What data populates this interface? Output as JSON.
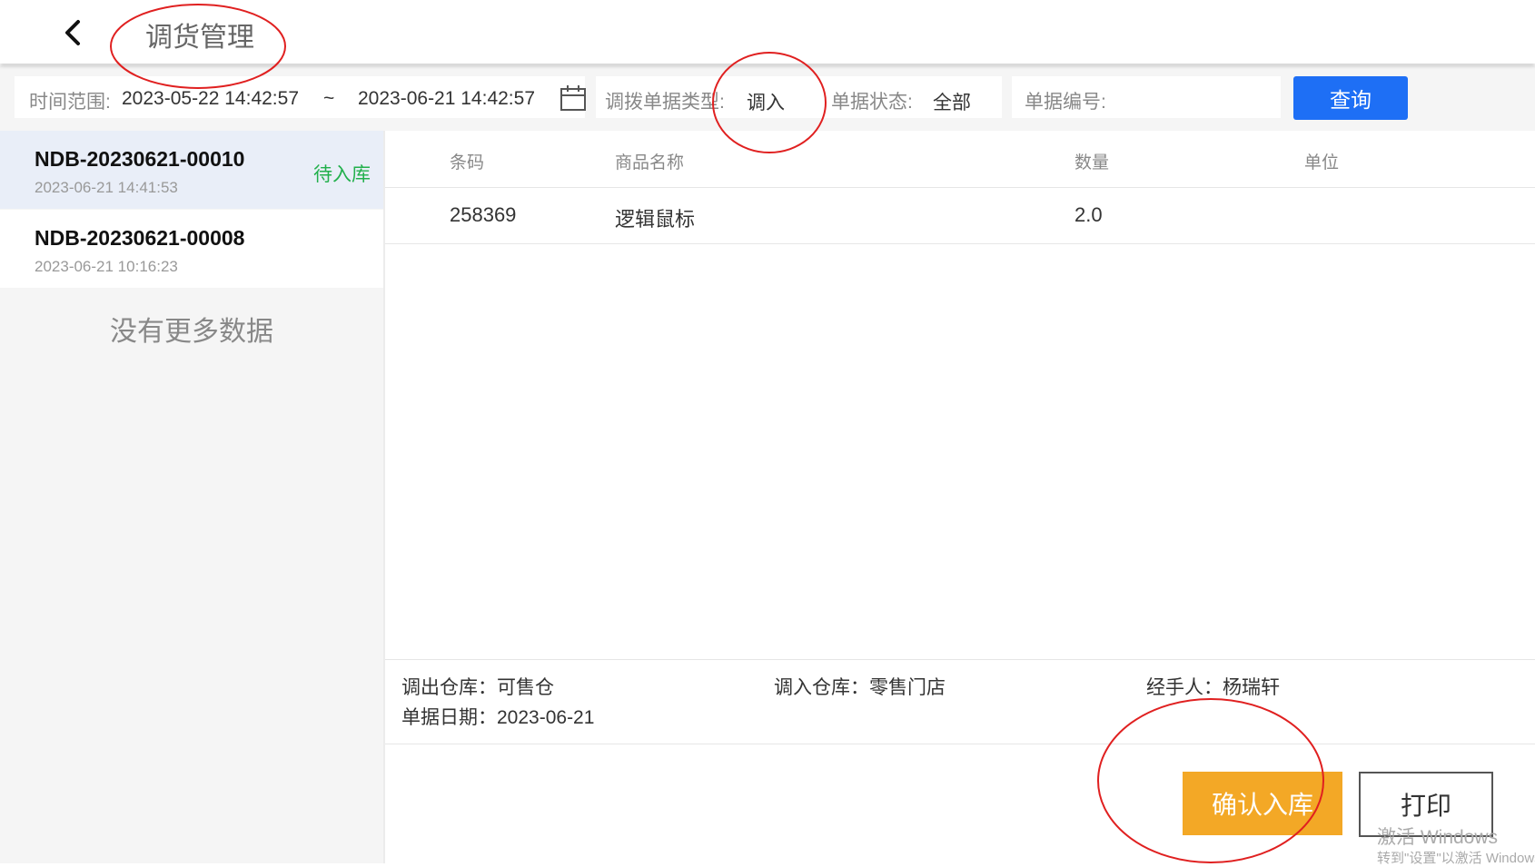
{
  "header": {
    "title": "调货管理"
  },
  "filters": {
    "time_label": "时间范围:",
    "start": "2023-05-22 14:42:57",
    "tilde": "~",
    "end": "2023-06-21 14:42:57",
    "type_label": "调拨单据类型:",
    "type_value": "调入",
    "status_label": "单据状态:",
    "status_value": "全部",
    "number_label": "单据编号:",
    "number_value": "",
    "query_label": "查询"
  },
  "orders": [
    {
      "no": "NDB-20230621-00010",
      "time": "2023-06-21 14:41:53",
      "status": "待入库"
    },
    {
      "no": "NDB-20230621-00008",
      "time": "2023-06-21 10:16:23",
      "status": ""
    }
  ],
  "no_more": "没有更多数据",
  "table": {
    "headers": [
      "条码",
      "商品名称",
      "数量",
      "单位"
    ],
    "rows": [
      [
        "258369",
        "逻辑鼠标",
        "2.0",
        ""
      ]
    ]
  },
  "info": {
    "out_warehouse": "调出仓库：可售仓",
    "in_warehouse": "调入仓库：零售门店",
    "handler": "经手人：杨瑞轩",
    "date": "单据日期：2023-06-21"
  },
  "actions": {
    "confirm": "确认入库",
    "print": "打印"
  },
  "watermark": {
    "line1": "激活 Windows",
    "line2": "转到\"设置\"以激活 Windows。"
  },
  "colors": {
    "primary": "#1e6ff5",
    "confirm": "#f3a826",
    "status_green": "#22b04c",
    "annotation_red": "#e02020"
  }
}
